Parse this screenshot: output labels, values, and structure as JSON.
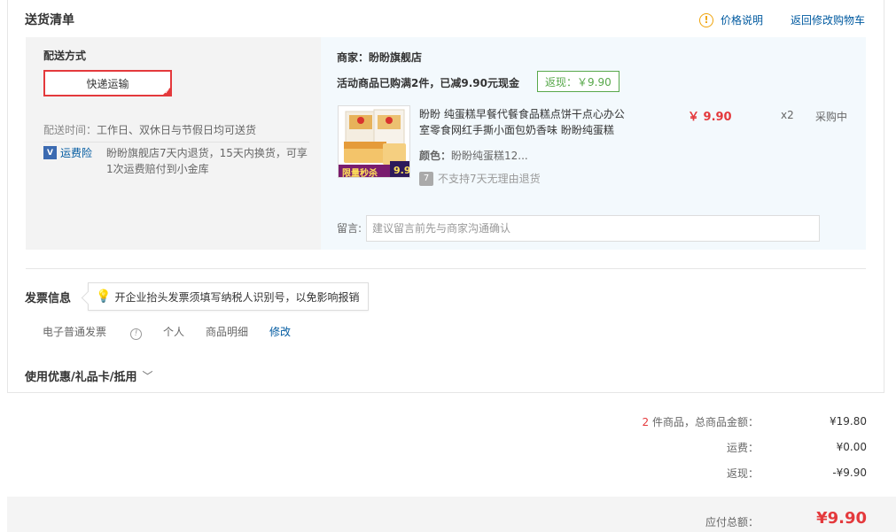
{
  "header": {
    "title": "送货清单",
    "price_note": "价格说明",
    "back_cart": "返回修改购物车"
  },
  "shipping": {
    "title": "配送方式",
    "method": "快递运输",
    "time_label": "配送时间：",
    "time_value": "工作日、双休日与节假日均可送货",
    "insurance_label": "运费险",
    "insurance_desc": "盼盼旗舰店7天内退货，15天内换货，可享1次运费赔付到小金库"
  },
  "shop": {
    "name": "商家：盼盼旗舰店",
    "promo": "活动商品已购满2件，已减9.90元现金",
    "rebate": "返现：￥9.90",
    "product": {
      "title": "盼盼 纯蛋糕早餐代餐食品糕点饼干点心办公室零食网红手撕小面包奶香味 盼盼纯蛋糕",
      "price": "￥ 9.90",
      "qty": "x2",
      "stock": "采购中",
      "color_label": "颜色：",
      "color_value": "盼盼纯蛋糕12...",
      "no_return": "不支持7天无理由退货",
      "img_badge": "限量秒杀",
      "img_badge_price": "9.9"
    },
    "message_label": "留言:",
    "message_placeholder": "建议留言前先与商家沟通确认"
  },
  "invoice": {
    "title": "发票信息",
    "tip": "开企业抬头发票须填写纳税人识别号，以免影响报销",
    "type": "电子普通发票",
    "holder": "个人",
    "content": "商品明细",
    "edit": "修改"
  },
  "coupon": {
    "title": "使用优惠/礼品卡/抵用"
  },
  "summary": {
    "count": "2",
    "goods_label": " 件商品，总商品金额：",
    "goods_value": "¥19.80",
    "freight_label": "运费：",
    "freight_value": "¥0.00",
    "rebate_label": "返现：",
    "rebate_value": "-¥9.90",
    "total_label": "应付总额：",
    "total_value": "¥9.90"
  },
  "colors": {
    "accent_red": "#e4393c",
    "link_blue": "#005aa0",
    "rebate_green": "#58a84b"
  }
}
